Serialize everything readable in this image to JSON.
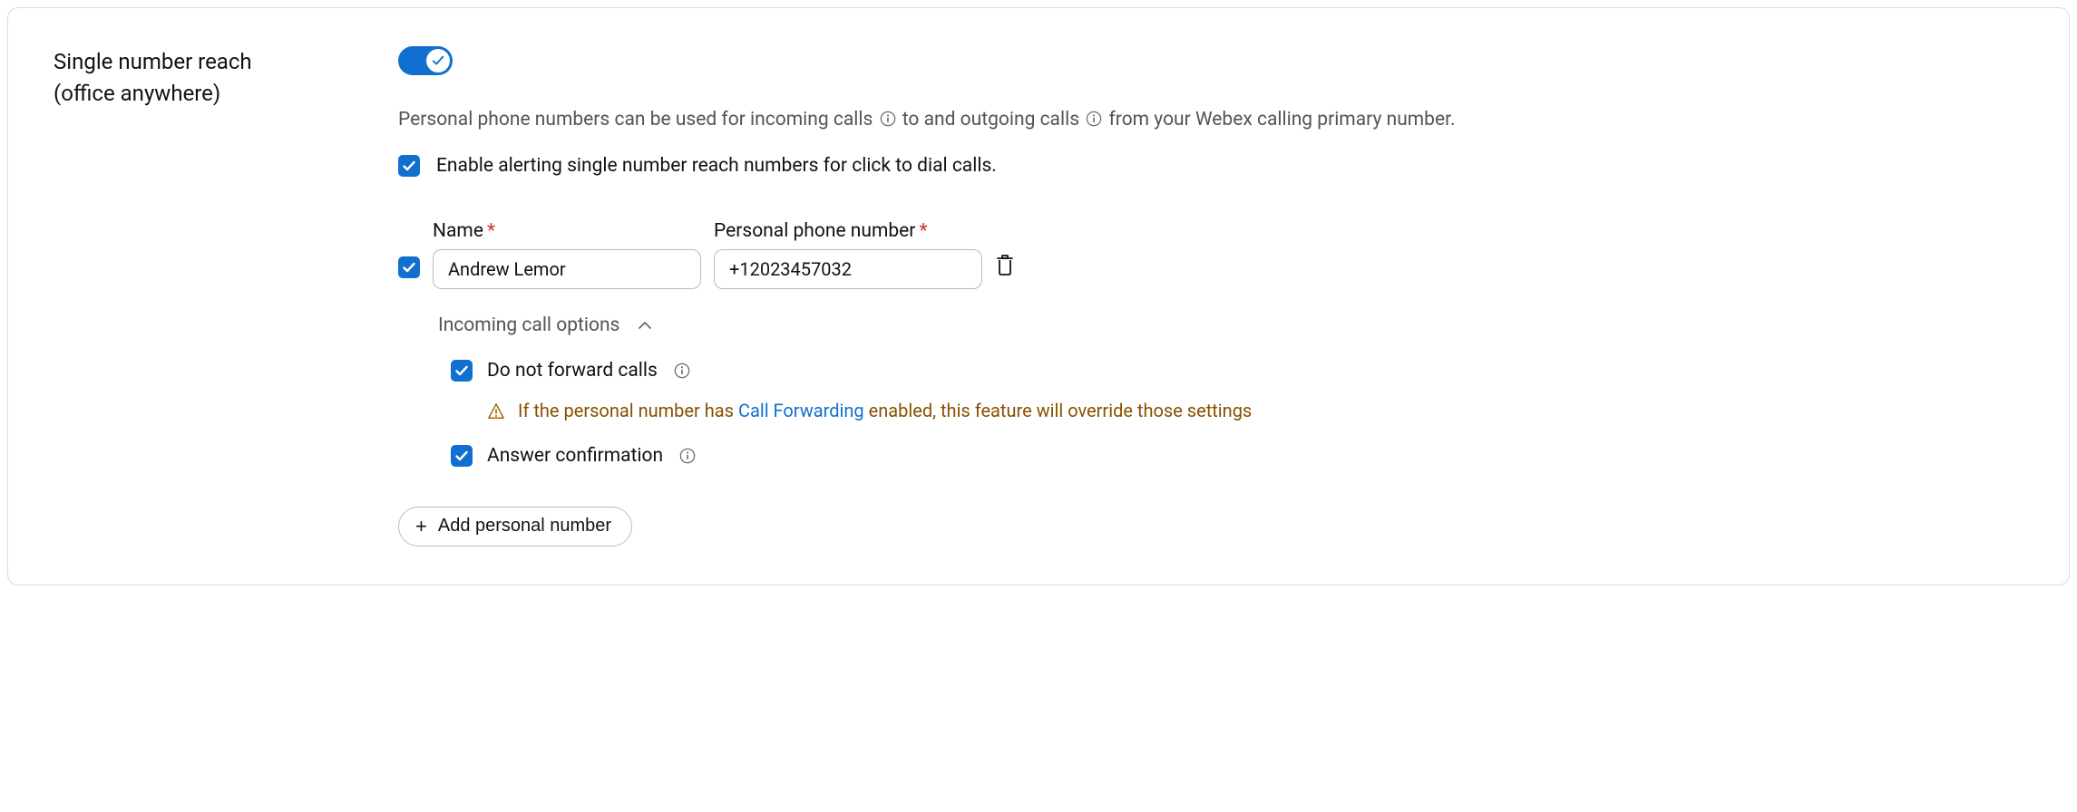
{
  "section": {
    "title_line1": "Single number reach",
    "title_line2": "(office anywhere)"
  },
  "toggle": {
    "checked": true
  },
  "description": {
    "part1": "Personal phone numbers can be used for incoming calls",
    "part2": "to and outgoing calls",
    "part3": "from your Webex calling primary number."
  },
  "enable_alerting": {
    "checked": true,
    "label": "Enable alerting single number reach numbers for click to dial calls."
  },
  "entry": {
    "row_checked": true,
    "name_label": "Name",
    "name_value": "Andrew Lemor",
    "phone_label": "Personal phone number",
    "phone_value": "+12023457032"
  },
  "incoming_options": {
    "label": "Incoming call options",
    "do_not_forward": {
      "checked": true,
      "label": "Do not forward calls"
    },
    "warning": {
      "prefix": "If the personal number has",
      "link": "Call Forwarding",
      "suffix": "enabled, this feature will override those settings"
    },
    "answer_confirmation": {
      "checked": true,
      "label": "Answer confirmation"
    }
  },
  "add_button": {
    "label": "Add personal number"
  }
}
